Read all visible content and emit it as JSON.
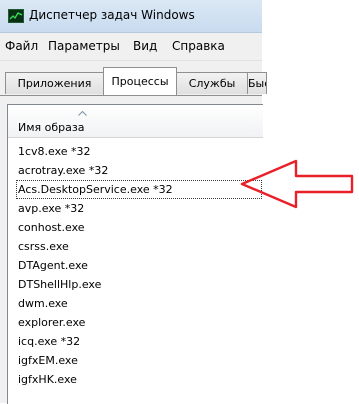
{
  "window": {
    "title": "Диспетчер задач Windows"
  },
  "menu": {
    "items": [
      "Файл",
      "Параметры",
      "Вид",
      "Справка"
    ]
  },
  "tabs": [
    {
      "label": "Приложения",
      "active": false
    },
    {
      "label": "Процессы",
      "active": true
    },
    {
      "label": "Службы",
      "active": false
    },
    {
      "label": "Быстродействие",
      "active": false
    }
  ],
  "table": {
    "column_header": "Имя образа",
    "rows": [
      "1cv8.exe *32",
      "acrotray.exe *32",
      "Acs.DesktopService.exe *32",
      "avp.exe *32",
      "conhost.exe",
      "csrss.exe",
      "DTAgent.exe",
      "DTShellHlp.exe",
      "dwm.exe",
      "explorer.exe",
      "icq.exe *32",
      "igfxEM.exe",
      "igfxHK.exe"
    ],
    "selected_index": 2
  },
  "annotation": {
    "arrow_color": "#e8202a"
  }
}
